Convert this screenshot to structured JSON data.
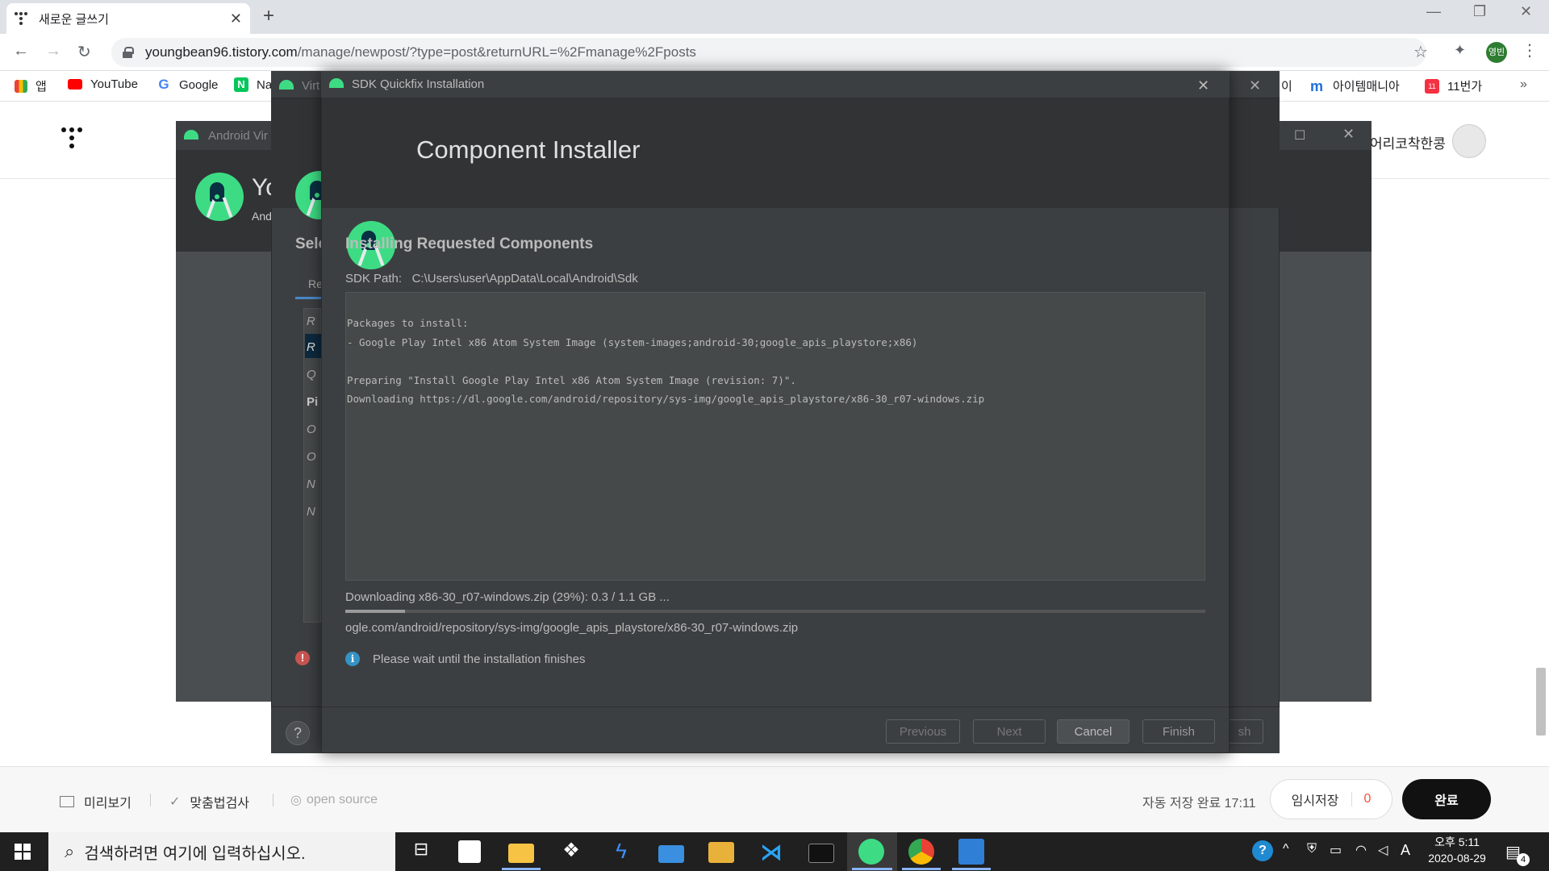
{
  "browser": {
    "tab_title": "새로운 글쓰기",
    "url_host": "youngbean96.tistory.com",
    "url_path": "/manage/newpost/?type=post&returnURL=%2Fmanage%2Fposts",
    "profile_badge": "영빈"
  },
  "bookmarks": [
    {
      "label": "앱",
      "color": "#ea4335"
    },
    {
      "label": "YouTube",
      "color": "#ff0000"
    },
    {
      "label": "Google",
      "color": "#4285f4"
    },
    {
      "label": "Na",
      "color": "#03c75a"
    },
    {
      "label": "이",
      "color": "#888888"
    },
    {
      "label": "아이템매니아",
      "color": "#1e6ed8"
    },
    {
      "label": "11번가",
      "color": "#f43142"
    }
  ],
  "blog": {
    "user_name": "어리코착한콩",
    "preview_label": "미리보기",
    "spellcheck_label": "맞춤법검사",
    "opensource_label": "open source",
    "autosave_text": "자동 저장 완료 17:11",
    "draft_label": "임시저장",
    "draft_count": "0",
    "done_label": "완료"
  },
  "avd_window": {
    "title": "Android Vir",
    "heading": "Yo",
    "sub": "And"
  },
  "wizard_window": {
    "title": "Virt",
    "section": "Sele",
    "tab": "Re",
    "rows": [
      "R",
      "R",
      "Q",
      "Pi",
      "O",
      "O",
      "N",
      "N"
    ],
    "finish_partial": "sh"
  },
  "dialog": {
    "title": "SDK Quickfix Installation",
    "heading": "Component Installer",
    "section_title": "Installing Requested Components",
    "sdk_path_label": "SDK Path:",
    "sdk_path_value": "C:\\Users\\user\\AppData\\Local\\Android\\Sdk",
    "log_lines": [
      "Packages to install:",
      "- Google Play Intel x86 Atom System Image (system-images;android-30;google_apis_playstore;x86)",
      "",
      "Preparing \"Install Google Play Intel x86 Atom System Image (revision: 7)\".",
      "Downloading https://dl.google.com/android/repository/sys-img/google_apis_playstore/x86-30_r07-windows.zip"
    ],
    "progress_label": "Downloading x86-30_r07-windows.zip (29%): 0.3 / 1.1 GB ...",
    "progress_percent": 29,
    "progress_url": "ogle.com/android/repository/sys-img/google_apis_playstore/x86-30_r07-windows.zip",
    "info_text": "Please wait until the installation finishes",
    "buttons": {
      "previous": "Previous",
      "next": "Next",
      "cancel": "Cancel",
      "finish": "Finish"
    }
  },
  "taskbar": {
    "search_placeholder": "검색하려면 여기에 입력하십시오.",
    "time": "오후 5:11",
    "date": "2020-08-29",
    "ime": "A",
    "notification_count": "4"
  }
}
